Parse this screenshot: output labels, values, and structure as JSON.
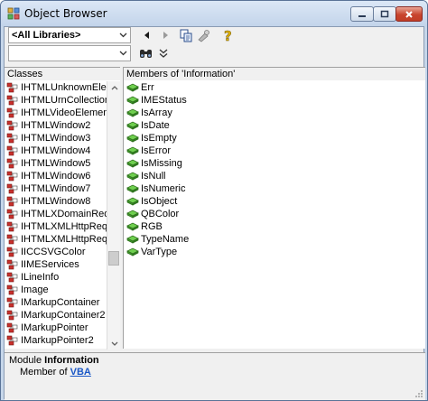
{
  "window": {
    "title": "Object Browser"
  },
  "toolbar": {
    "library_selected": "<All Libraries>",
    "search_value": ""
  },
  "classes": {
    "header": "Classes",
    "items": [
      "IHTMLUnknownElen",
      "IHTMLUrnCollection",
      "IHTMLVideoElement",
      "IHTMLWindow2",
      "IHTMLWindow3",
      "IHTMLWindow4",
      "IHTMLWindow5",
      "IHTMLWindow6",
      "IHTMLWindow7",
      "IHTMLWindow8",
      "IHTMLXDomainRequ",
      "IHTMLXMLHttpRequ",
      "IHTMLXMLHttpRequ",
      "IICCSVGColor",
      "IIMEServices",
      "ILineInfo",
      "Image",
      "IMarkupContainer",
      "IMarkupContainer2",
      "IMarkupPointer",
      "IMarkupPointer2"
    ]
  },
  "members": {
    "header": "Members of 'Information'",
    "items": [
      "Err",
      "IMEStatus",
      "IsArray",
      "IsDate",
      "IsEmpty",
      "IsError",
      "IsMissing",
      "IsNull",
      "IsNumeric",
      "IsObject",
      "QBColor",
      "RGB",
      "TypeName",
      "VarType"
    ]
  },
  "details": {
    "kind": "Module",
    "name": "Information",
    "member_of_label": "Member of",
    "library": "VBA"
  },
  "icons": {
    "app": "object-browser-icon",
    "class": "class-module-icon",
    "member": "method-icon"
  },
  "colors": {
    "title_bg": "#c9d9ee",
    "close_button": "#c8452f",
    "link": "#1a57c6",
    "member_icon": "#3aa63a"
  }
}
